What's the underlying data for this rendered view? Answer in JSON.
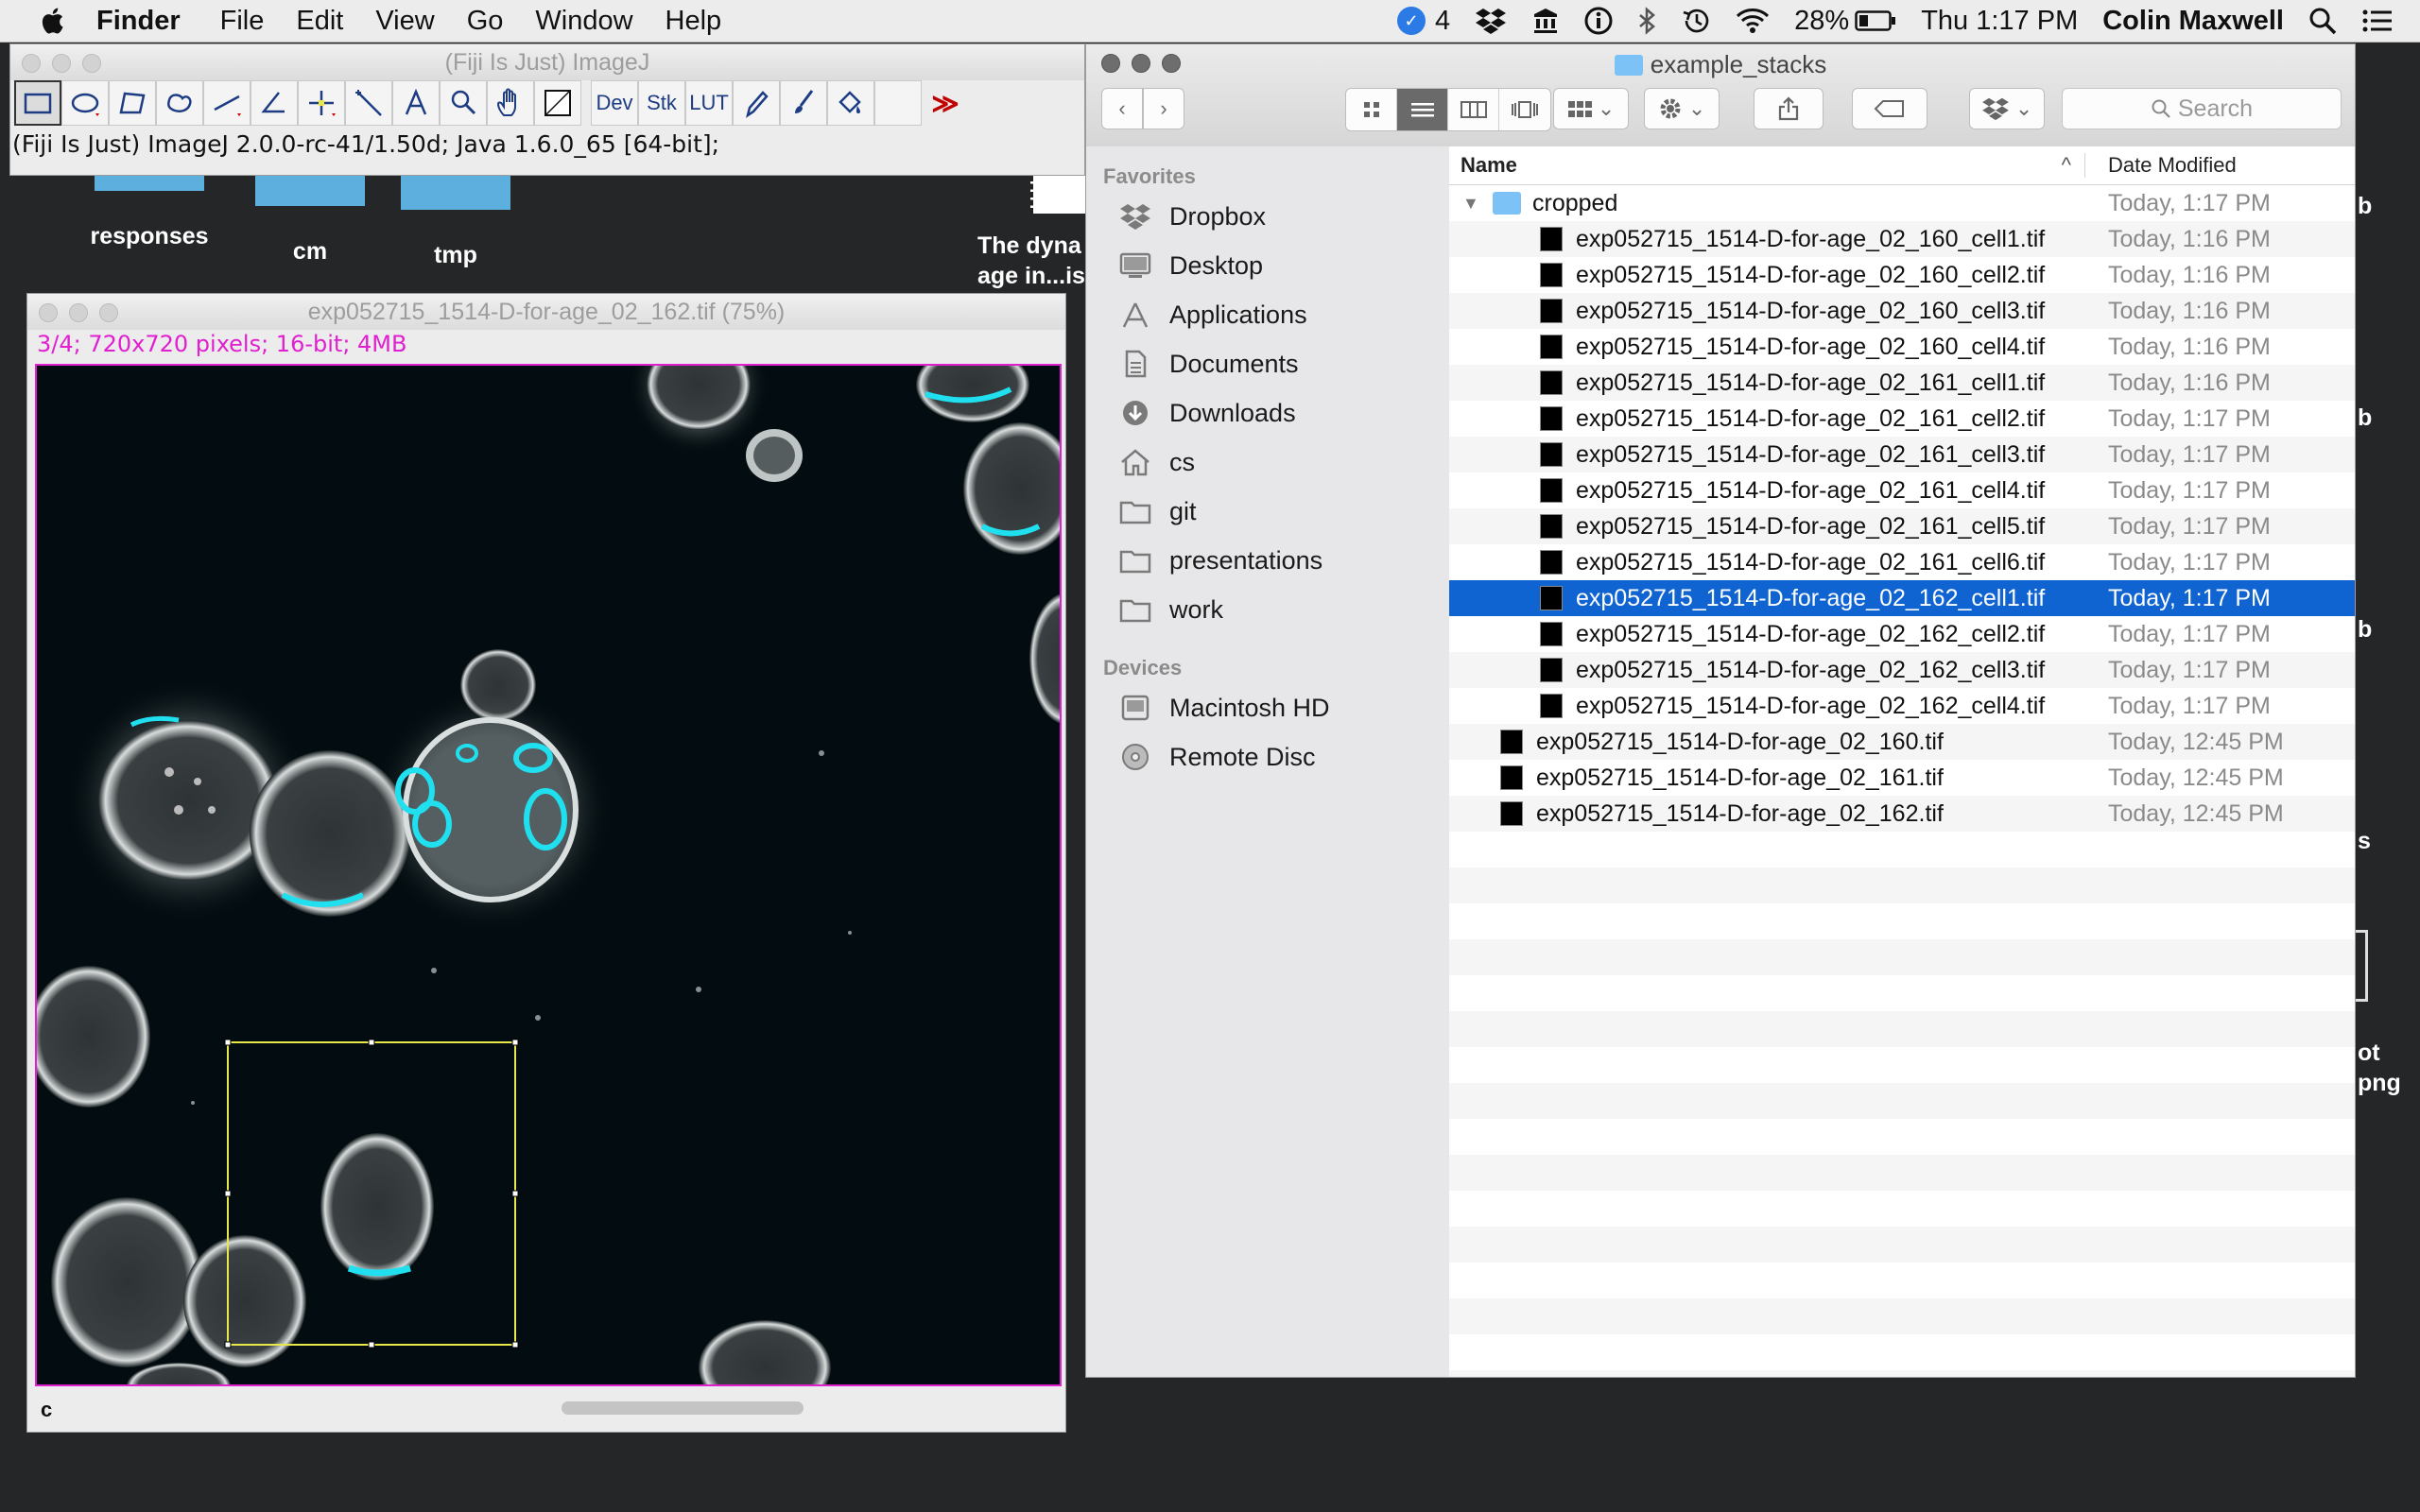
{
  "menubar": {
    "app": "Finder",
    "menus": [
      "File",
      "Edit",
      "View",
      "Go",
      "Window",
      "Help"
    ],
    "notification_count": "4",
    "battery": "28%",
    "clock": "Thu 1:17 PM",
    "user": "Colin Maxwell"
  },
  "desktop": {
    "icons": [
      "responses",
      "cm",
      "tmp"
    ],
    "partial_text_1": "The dyna",
    "partial_text_2": "age in...is",
    "right_fragments": [
      "b",
      "b",
      "b",
      "s",
      "ot",
      "png"
    ]
  },
  "imagej": {
    "title": "(Fiji Is Just) ImageJ",
    "tools_text": [
      "Dev",
      "Stk",
      "LUT"
    ],
    "more": "≫",
    "status": "(Fiji Is Just) ImageJ 2.0.0-rc-41/1.50d; Java 1.6.0_65 [64-bit];"
  },
  "image_window": {
    "title": "exp052715_1514-D-for-age_02_162.tif (75%)",
    "info": "3/4; 720x720 pixels; 16-bit; 4MB",
    "channel": "c"
  },
  "finder": {
    "title": "example_stacks",
    "search_placeholder": "Search",
    "sidebar": {
      "favorites_label": "Favorites",
      "favorites": [
        {
          "label": "Dropbox",
          "icon": "dropbox-icon"
        },
        {
          "label": "Desktop",
          "icon": "desktop-icon"
        },
        {
          "label": "Applications",
          "icon": "applications-icon"
        },
        {
          "label": "Documents",
          "icon": "documents-icon"
        },
        {
          "label": "Downloads",
          "icon": "downloads-icon"
        },
        {
          "label": "cs",
          "icon": "home-icon"
        },
        {
          "label": "git",
          "icon": "folder-icon"
        },
        {
          "label": "presentations",
          "icon": "folder-icon"
        },
        {
          "label": "work",
          "icon": "folder-icon"
        }
      ],
      "devices_label": "Devices",
      "devices": [
        {
          "label": "Macintosh HD",
          "icon": "hard-drive-icon"
        },
        {
          "label": "Remote Disc",
          "icon": "disc-icon"
        }
      ]
    },
    "columns": {
      "name": "Name",
      "date": "Date Modified"
    },
    "rows": [
      {
        "name": "cropped",
        "date": "Today, 1:17 PM",
        "kind": "folder"
      },
      {
        "name": "exp052715_1514-D-for-age_02_160_cell1.tif",
        "date": "Today, 1:16 PM",
        "kind": "child"
      },
      {
        "name": "exp052715_1514-D-for-age_02_160_cell2.tif",
        "date": "Today, 1:16 PM",
        "kind": "child"
      },
      {
        "name": "exp052715_1514-D-for-age_02_160_cell3.tif",
        "date": "Today, 1:16 PM",
        "kind": "child"
      },
      {
        "name": "exp052715_1514-D-for-age_02_160_cell4.tif",
        "date": "Today, 1:16 PM",
        "kind": "child"
      },
      {
        "name": "exp052715_1514-D-for-age_02_161_cell1.tif",
        "date": "Today, 1:16 PM",
        "kind": "child"
      },
      {
        "name": "exp052715_1514-D-for-age_02_161_cell2.tif",
        "date": "Today, 1:17 PM",
        "kind": "child"
      },
      {
        "name": "exp052715_1514-D-for-age_02_161_cell3.tif",
        "date": "Today, 1:17 PM",
        "kind": "child"
      },
      {
        "name": "exp052715_1514-D-for-age_02_161_cell4.tif",
        "date": "Today, 1:17 PM",
        "kind": "child"
      },
      {
        "name": "exp052715_1514-D-for-age_02_161_cell5.tif",
        "date": "Today, 1:17 PM",
        "kind": "child"
      },
      {
        "name": "exp052715_1514-D-for-age_02_161_cell6.tif",
        "date": "Today, 1:17 PM",
        "kind": "child"
      },
      {
        "name": "exp052715_1514-D-for-age_02_162_cell1.tif",
        "date": "Today, 1:17 PM",
        "kind": "child",
        "selected": true
      },
      {
        "name": "exp052715_1514-D-for-age_02_162_cell2.tif",
        "date": "Today, 1:17 PM",
        "kind": "child"
      },
      {
        "name": "exp052715_1514-D-for-age_02_162_cell3.tif",
        "date": "Today, 1:17 PM",
        "kind": "child"
      },
      {
        "name": "exp052715_1514-D-for-age_02_162_cell4.tif",
        "date": "Today, 1:17 PM",
        "kind": "child"
      },
      {
        "name": "exp052715_1514-D-for-age_02_160.tif",
        "date": "Today, 12:45 PM",
        "kind": "file"
      },
      {
        "name": "exp052715_1514-D-for-age_02_161.tif",
        "date": "Today, 12:45 PM",
        "kind": "file"
      },
      {
        "name": "exp052715_1514-D-for-age_02_162.tif",
        "date": "Today, 12:45 PM",
        "kind": "file"
      }
    ]
  },
  "colors": {
    "selection": "#0f64d2",
    "roi": "#e8e84a",
    "info_magenta": "#e020d0",
    "cyan": "#20e0f0"
  }
}
